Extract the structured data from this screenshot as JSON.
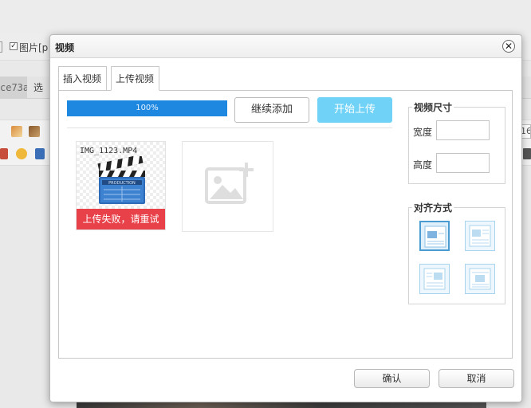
{
  "background": {
    "image_label": "图片[p",
    "hash_tab": "ce73a",
    "selected_tab": "选",
    "right_number": "16"
  },
  "dialog": {
    "title": "视频",
    "close_symbol": "✕",
    "tabs": [
      {
        "label": "插入视频",
        "active": false
      },
      {
        "label": "上传视频",
        "active": true
      }
    ],
    "upload": {
      "progress_text": "100%",
      "progress_value": 1.0,
      "continue_label": "继续添加",
      "start_label": "开始上传",
      "files": [
        {
          "name": "IMG_1123.MP4",
          "status": "上传失败，请重试",
          "thumb_text": "PRODUCTION",
          "icon": "clapperboard-icon"
        }
      ],
      "add_icon": "add-image-icon"
    },
    "size": {
      "legend": "视频尺寸",
      "width_label": "宽度",
      "width_value": "",
      "height_label": "高度",
      "height_value": ""
    },
    "align": {
      "legend": "对齐方式",
      "options": [
        {
          "id": "none",
          "active": true
        },
        {
          "id": "left",
          "active": false
        },
        {
          "id": "right",
          "active": false
        },
        {
          "id": "center",
          "active": false
        }
      ]
    },
    "footer": {
      "ok_label": "确认",
      "cancel_label": "取消"
    }
  },
  "colors": {
    "progress": "#1e88e0",
    "start_button": "#6fd2f6",
    "error": "#e8414a",
    "align_active": "#4a9bd2"
  }
}
